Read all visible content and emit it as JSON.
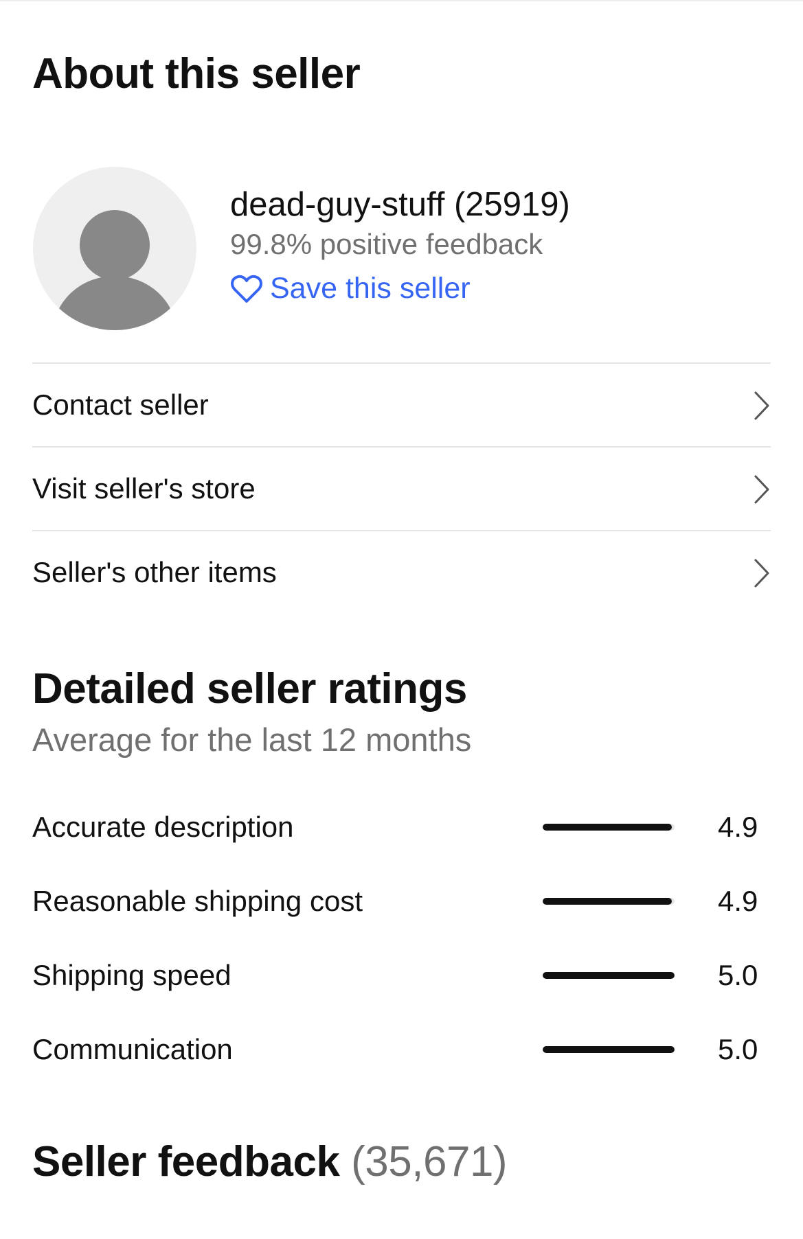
{
  "about": {
    "title": "About this seller"
  },
  "seller": {
    "name": "dead-guy-stuff (25919)",
    "feedback": "99.8% positive feedback",
    "save_label": "Save this seller"
  },
  "nav": {
    "items": [
      {
        "label": "Contact seller"
      },
      {
        "label": "Visit seller's store"
      },
      {
        "label": "Seller's other items"
      }
    ]
  },
  "ratings": {
    "title": "Detailed seller ratings",
    "subtitle": "Average for the last 12 months",
    "max": 5.0,
    "items": [
      {
        "label": "Accurate description",
        "value": "4.9"
      },
      {
        "label": "Reasonable shipping cost",
        "value": "4.9"
      },
      {
        "label": "Shipping speed",
        "value": "5.0"
      },
      {
        "label": "Communication",
        "value": "5.0"
      }
    ]
  },
  "feedback": {
    "title": "Seller feedback",
    "count": "(35,671)"
  },
  "colors": {
    "link": "#3665f3",
    "secondary_text": "#707070",
    "primary_text": "#111111",
    "avatar_bg": "#efefef",
    "avatar_figure": "#888888"
  },
  "icons": {
    "avatar": "person-silhouette",
    "save": "heart-outline-icon",
    "nav": "chevron-right-icon"
  }
}
